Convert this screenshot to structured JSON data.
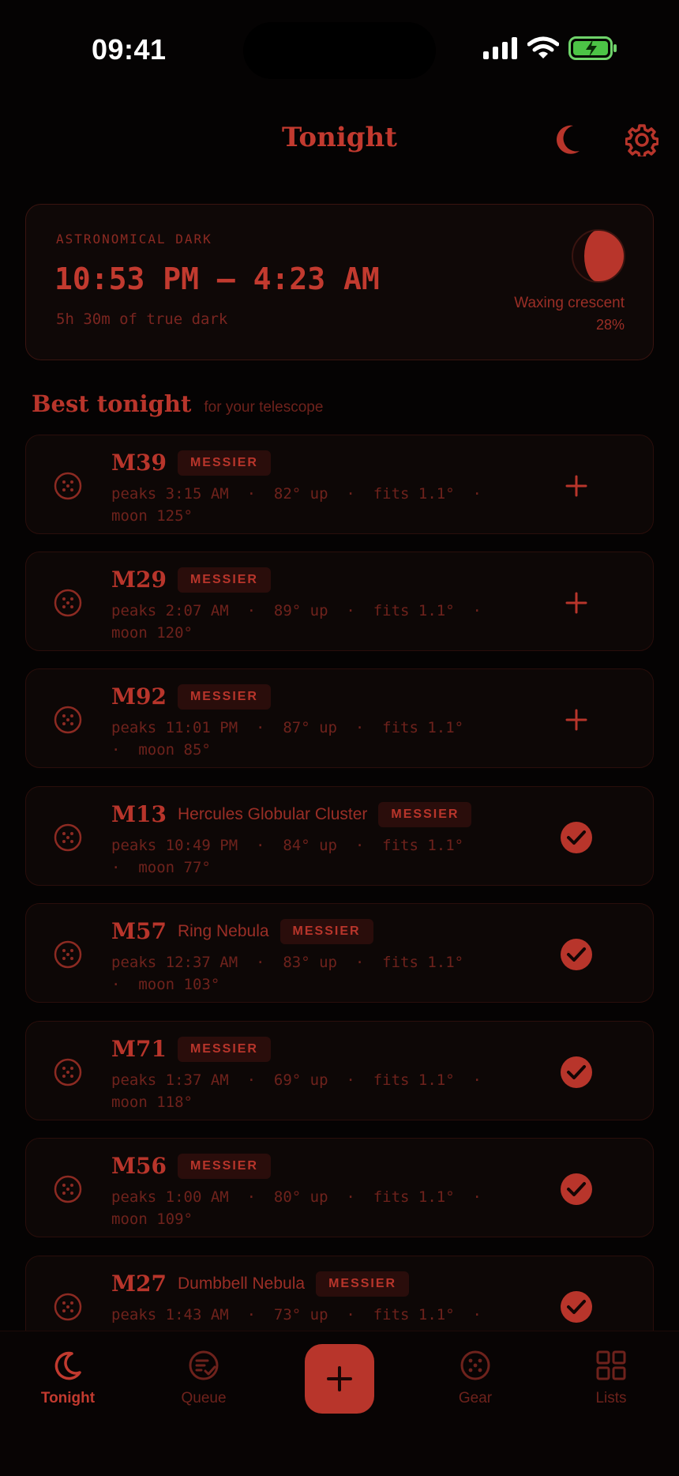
{
  "status_bar": {
    "time": "09:41"
  },
  "header": {
    "title": "Tonight"
  },
  "dark_window": {
    "label": "ASTRONOMICAL DARK",
    "range": "10:53 PM – 4:23 AM",
    "duration": "5h 30m of true dark",
    "moon_phase": "Waxing crescent",
    "moon_illumination": "28%"
  },
  "section": {
    "title": "Best tonight",
    "subtitle": "for your telescope"
  },
  "items": [
    {
      "code": "M39",
      "common": "",
      "badge": "MESSIER",
      "meta": "peaks 3:15 AM  ·  82° up  ·  fits 1.1°  ·\nmoon 125°",
      "status": "add"
    },
    {
      "code": "M29",
      "common": "",
      "badge": "MESSIER",
      "meta": "peaks 2:07 AM  ·  89° up  ·  fits 1.1°  ·\nmoon 120°",
      "status": "add"
    },
    {
      "code": "M92",
      "common": "",
      "badge": "MESSIER",
      "meta": "peaks 11:01 PM  ·  87° up  ·  fits 1.1°\n·  moon 85°",
      "status": "add"
    },
    {
      "code": "M13",
      "common": "Hercules Globular Cluster",
      "badge": "MESSIER",
      "meta": "peaks 10:49 PM  ·  84° up  ·  fits 1.1°\n·  moon 77°",
      "status": "added"
    },
    {
      "code": "M57",
      "common": "Ring Nebula",
      "badge": "MESSIER",
      "meta": "peaks 12:37 AM  ·  83° up  ·  fits 1.1°\n·  moon 103°",
      "status": "added"
    },
    {
      "code": "M71",
      "common": "",
      "badge": "MESSIER",
      "meta": "peaks 1:37 AM  ·  69° up  ·  fits 1.1°  ·\nmoon 118°",
      "status": "added"
    },
    {
      "code": "M56",
      "common": "",
      "badge": "MESSIER",
      "meta": "peaks 1:00 AM  ·  80° up  ·  fits 1.1°  ·\nmoon 109°",
      "status": "added"
    },
    {
      "code": "M27",
      "common": "Dumbbell Nebula",
      "badge": "MESSIER",
      "meta": "peaks 1:43 AM  ·  73° up  ·  fits 1.1°  ·",
      "status": "added"
    }
  ],
  "tabs": [
    {
      "label": "Tonight",
      "icon": "moon-icon",
      "active": true
    },
    {
      "label": "Queue",
      "icon": "queue-check-icon",
      "active": false
    },
    {
      "label": "Gear",
      "icon": "gear-dots-icon",
      "active": false
    },
    {
      "label": "Lists",
      "icon": "grid-icon",
      "active": false
    }
  ],
  "colors": {
    "accent": "#b8352b",
    "background": "#050303",
    "card": "#0d0706"
  }
}
